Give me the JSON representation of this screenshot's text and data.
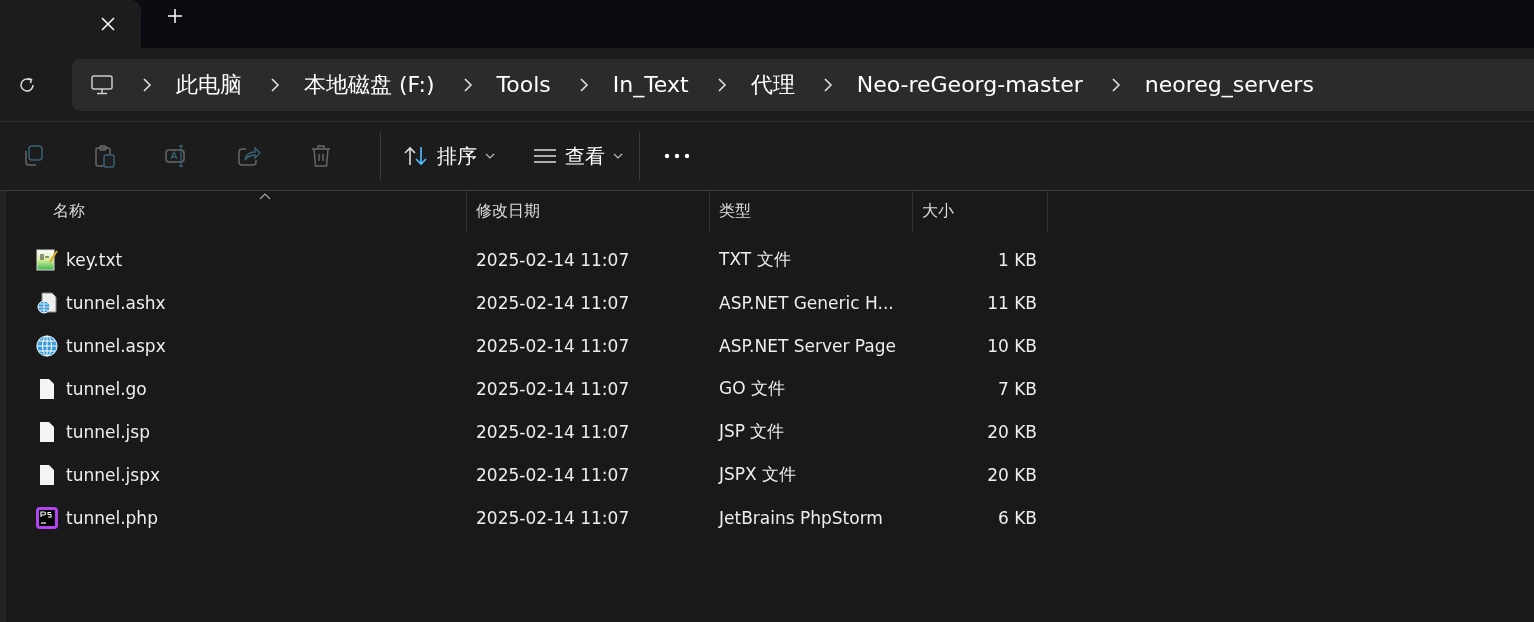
{
  "tab": {
    "active": true
  },
  "breadcrumb": [
    {
      "label": "此电脑"
    },
    {
      "label": "本地磁盘 (F:)"
    },
    {
      "label": "Tools"
    },
    {
      "label": "In_Text"
    },
    {
      "label": "代理"
    },
    {
      "label": "Neo-reGeorg-master"
    },
    {
      "label": "neoreg_servers"
    }
  ],
  "toolbar": {
    "actions": [
      {
        "kind": "copy",
        "disabled": true
      },
      {
        "kind": "paste",
        "disabled": true
      },
      {
        "kind": "rename",
        "disabled": true
      },
      {
        "kind": "share",
        "disabled": true
      },
      {
        "kind": "delete",
        "disabled": true
      }
    ],
    "sort": {
      "label": "排序"
    },
    "view": {
      "label": "查看"
    }
  },
  "table": {
    "columns": [
      {
        "label": "名称",
        "sorted": true
      },
      {
        "label": "修改日期",
        "sorted": false
      },
      {
        "label": "类型",
        "sorted": false
      },
      {
        "label": "大小",
        "sorted": false
      }
    ],
    "rows": [
      {
        "kind": "text",
        "name": "key.txt",
        "modified": "2025-02-14 11:07",
        "type": "TXT 文件",
        "size": "1 KB"
      },
      {
        "kind": "web-handler",
        "name": "tunnel.ashx",
        "modified": "2025-02-14 11:07",
        "type": "ASP.NET Generic H...",
        "size": "11 KB"
      },
      {
        "kind": "web",
        "name": "tunnel.aspx",
        "modified": "2025-02-14 11:07",
        "type": "ASP.NET Server Page",
        "size": "10 KB"
      },
      {
        "kind": "blank",
        "name": "tunnel.go",
        "modified": "2025-02-14 11:07",
        "type": "GO 文件",
        "size": "7 KB"
      },
      {
        "kind": "blank",
        "name": "tunnel.jsp",
        "modified": "2025-02-14 11:07",
        "type": "JSP 文件",
        "size": "20 KB"
      },
      {
        "kind": "blank",
        "name": "tunnel.jspx",
        "modified": "2025-02-14 11:07",
        "type": "JSPX 文件",
        "size": "20 KB"
      },
      {
        "kind": "phpstorm",
        "name": "tunnel.php",
        "modified": "2025-02-14 11:07",
        "type": "JetBrains PhpStorm",
        "size": "6 KB"
      }
    ]
  }
}
